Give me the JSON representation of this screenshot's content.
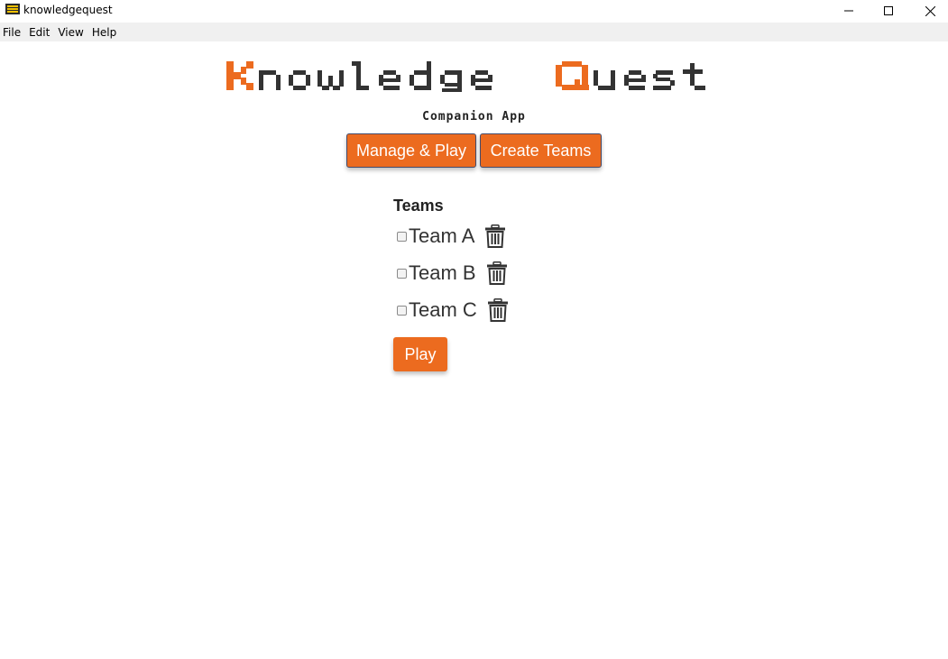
{
  "window": {
    "title": "knowledgequest",
    "controls": [
      "minimize-icon",
      "maximize-icon",
      "close-icon"
    ]
  },
  "menu": {
    "items": [
      "File",
      "Edit",
      "View",
      "Help"
    ]
  },
  "header": {
    "logo_text": "Knowledge Quest",
    "subtitle": "Companion App"
  },
  "nav": {
    "manage_label": "Manage & Play",
    "create_label": "Create Teams"
  },
  "teams": {
    "heading": "Teams",
    "list": [
      {
        "name": "Team A",
        "checked": false
      },
      {
        "name": "Team B",
        "checked": false
      },
      {
        "name": "Team C",
        "checked": false
      }
    ],
    "play_label": "Play"
  },
  "colors": {
    "accent": "#ec6b1f",
    "logo_dark": "#333333",
    "button_border": "#444b6b"
  }
}
